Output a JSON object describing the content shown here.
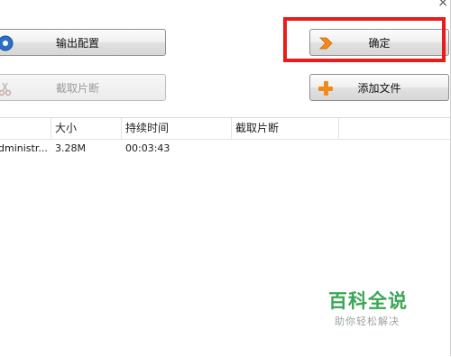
{
  "window": {
    "close_glyph": "×"
  },
  "buttons": {
    "output_config": "输出配置",
    "clip_segment": "截取片断",
    "confirm": "确定",
    "add_file": "添加文件"
  },
  "icons": {
    "output_config": "settings-disc-icon",
    "clip_segment": "scissors-icon",
    "confirm": "arrow-right-icon",
    "add_file": "plus-icon"
  },
  "highlight_color": "#e81c1c",
  "table": {
    "headers": [
      "",
      "大小",
      "持续时间",
      "截取片断",
      ""
    ],
    "rows": [
      [
        "dministr...",
        "3.28M",
        "00:03:43",
        "",
        ""
      ]
    ]
  },
  "watermark": {
    "main": "百科全说",
    "sub": "助你轻松解决"
  },
  "colors": {
    "watermark": "#3aa657",
    "accent_orange": "#f28a1a"
  }
}
